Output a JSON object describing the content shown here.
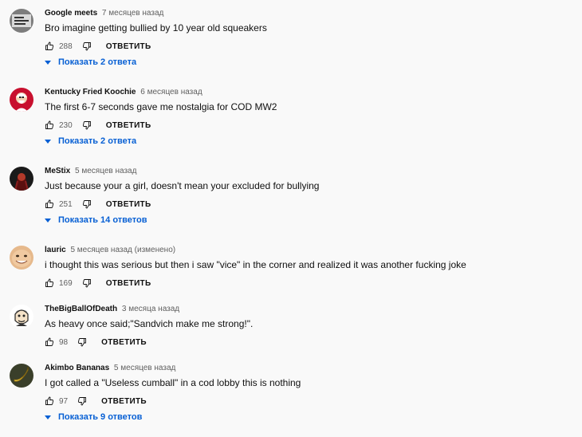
{
  "colors": {
    "background": "#f9f9f9",
    "text": "#0f0f0f",
    "meta": "#606060",
    "link": "#065fd4"
  },
  "comments": [
    {
      "author": "Google meets",
      "time": "7 месяцев назад",
      "text": "Bro imagine getting bullied by 10 year old squeakers",
      "likes": "288",
      "reply": "ОТВЕТИТЬ",
      "replies": "Показать 2 ответа",
      "avatar_icon": "google-meets-avatar"
    },
    {
      "author": "Kentucky Fried Koochie",
      "time": "6 месяцев назад",
      "text": "The first 6-7 seconds gave me nostalgia for COD MW2",
      "likes": "230",
      "reply": "ОТВЕТИТЬ",
      "replies": "Показать 2 ответа",
      "avatar_icon": "colonel-avatar"
    },
    {
      "author": "MeStix",
      "time": "5 месяцев назад",
      "text": "Just because your a girl, doesn't mean your excluded for bullying",
      "likes": "251",
      "reply": "ОТВЕТИТЬ",
      "replies": "Показать 14 ответов",
      "avatar_icon": "dark-character-avatar"
    },
    {
      "author": "lauric",
      "time": "5 месяцев назад (изменено)",
      "text": "i thought this was serious but then i saw \"vice\" in the corner and realized it was another fucking joke",
      "likes": "169",
      "reply": "ОТВЕТИТЬ",
      "avatar_icon": "face-avatar"
    },
    {
      "author": "TheBigBallOfDeath",
      "time": "3 месяца назад",
      "text": "As heavy once said;\"Sandvich make me strong!\".",
      "likes": "98",
      "reply": "ОТВЕТИТЬ",
      "avatar_icon": "cartoon-man-avatar"
    },
    {
      "author": "Akimbo Bananas",
      "time": "5 месяцев назад",
      "text": "I got called a \"Useless cumball\" in a cod lobby this is nothing",
      "likes": "97",
      "reply": "ОТВЕТИТЬ",
      "replies": "Показать 9 ответов",
      "avatar_icon": "banana-avatar"
    }
  ]
}
